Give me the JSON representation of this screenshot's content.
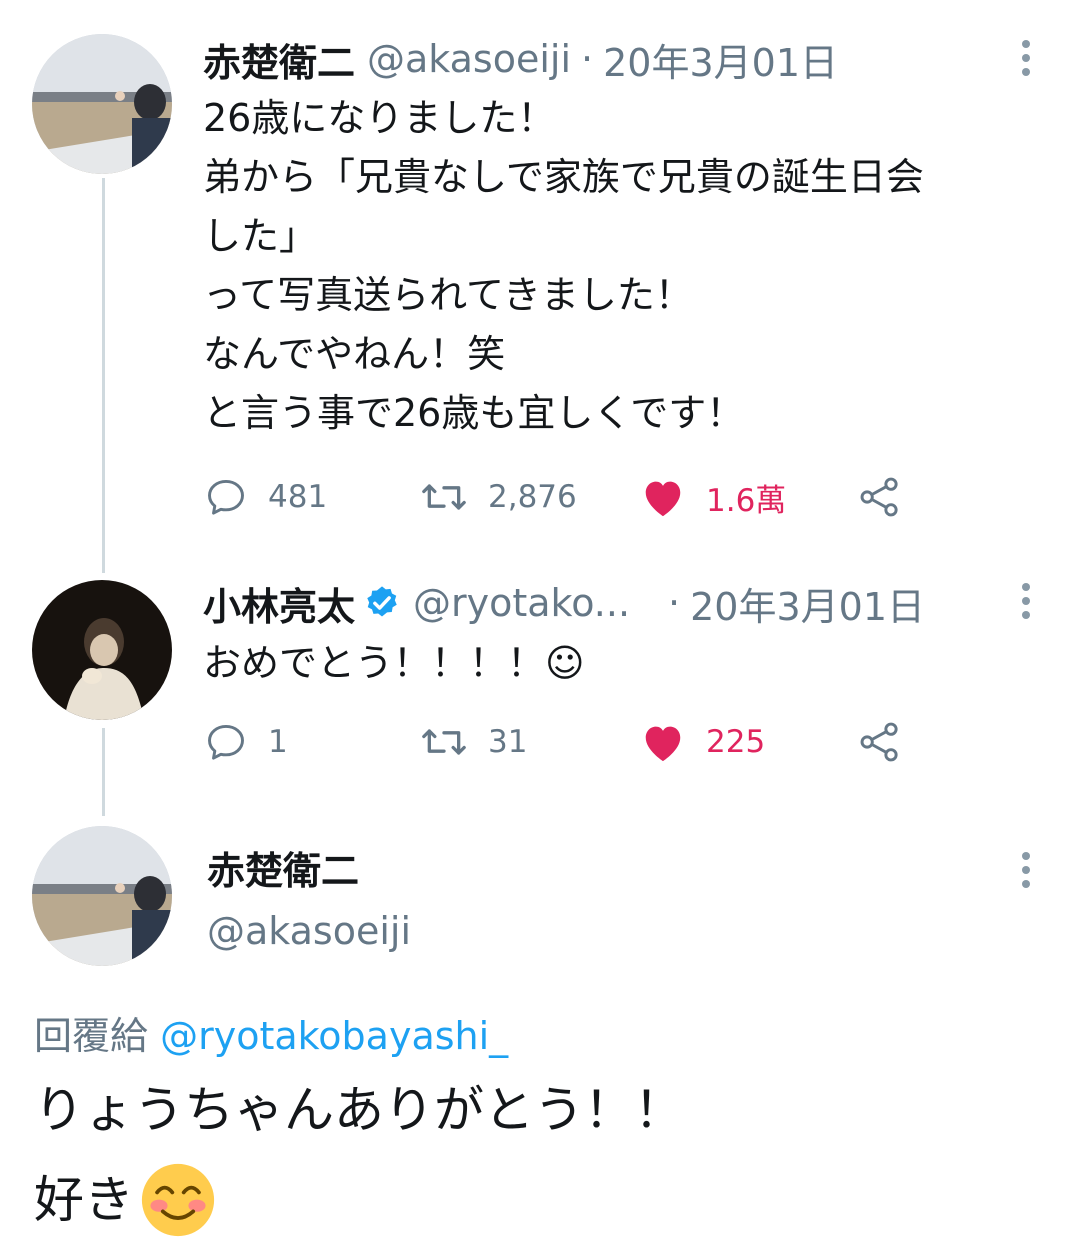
{
  "thread": {
    "tweet1": {
      "display_name": "赤楚衛二",
      "handle": "@akasoeiji",
      "separator": "·",
      "date": "20年3月01日",
      "lines": [
        "26歳になりました！",
        "弟から「兄貴なしで家族で兄貴の誕生日会",
        "した」",
        "って写真送られてきました！",
        "なんでやねん！笑",
        "と言う事で26歳も宜しくです！"
      ],
      "replies": "481",
      "retweets": "2,876",
      "likes": "1.6萬",
      "liked": true
    },
    "tweet2": {
      "display_name": "小林亮太",
      "verified": true,
      "handle": "@ryotako...",
      "separator": "·",
      "date": "20年3月01日",
      "text": "おめでとう！！！！☺",
      "replies": "1",
      "retweets": "31",
      "likes": "225",
      "liked": true
    },
    "main_tweet": {
      "display_name": "赤楚衛二",
      "handle": "@akasoeiji",
      "reply_label": "回覆給",
      "reply_mention": "@ryotakobayashi_",
      "line1": "りょうちゃんありがとう！！",
      "line2": "好き",
      "emoji": "smiling-face-with-blush"
    }
  },
  "colors": {
    "accent": "#1da1f2",
    "like": "#e0245e",
    "secondary_text": "#657786",
    "thread_line": "#cfd9de"
  }
}
